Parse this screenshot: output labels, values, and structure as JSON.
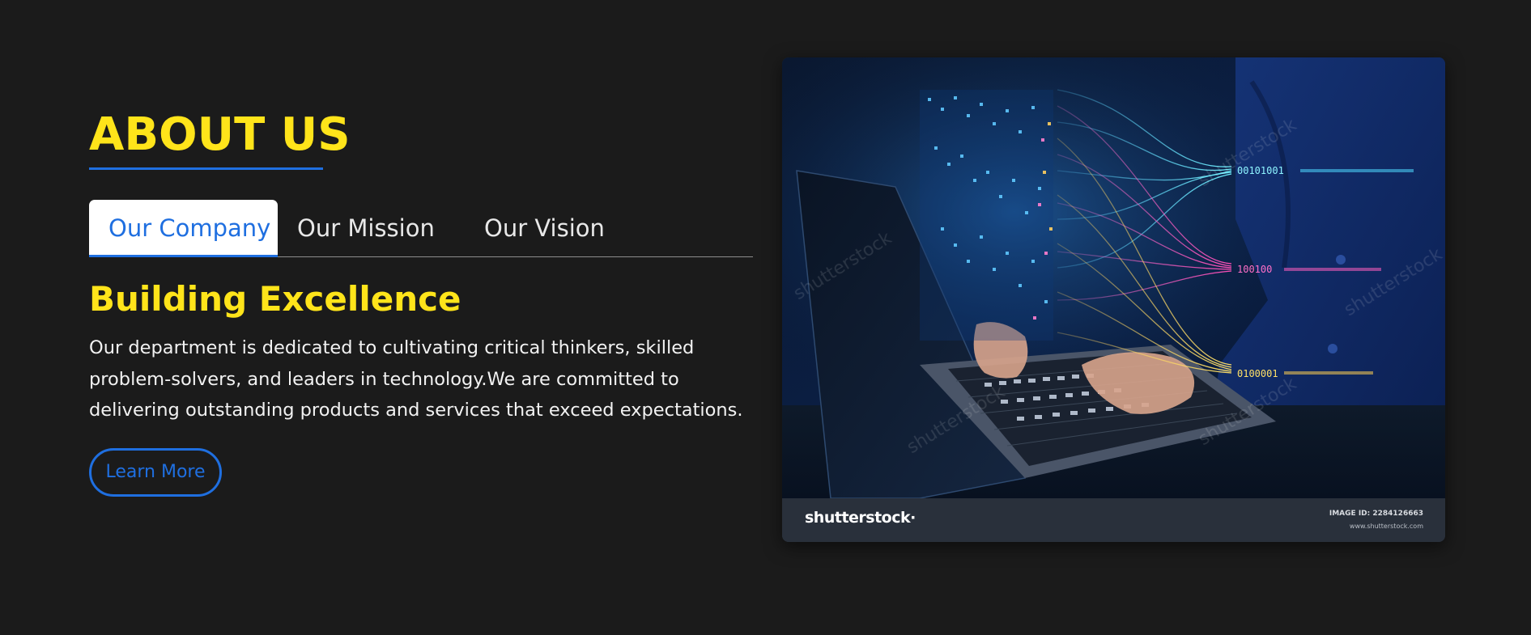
{
  "about": {
    "title": "ABOUT US",
    "tabs": [
      {
        "label": "Our Company",
        "active": true
      },
      {
        "label": "Our Mission",
        "active": false
      },
      {
        "label": "Our Vision",
        "active": false
      }
    ],
    "subheading": "Building Excellence",
    "body": "Our department is dedicated to cultivating critical thinkers, skilled problem-solvers, and leaders in technology.We are committed to delivering outstanding products and services that exceed expectations.",
    "cta_label": "Learn More"
  },
  "image": {
    "brand": "shutterstock",
    "brand_suffix": "·",
    "image_id_label": "IMAGE ID:",
    "image_id": "2284126663",
    "url": "www.shutterstock.com",
    "watermark": "shutterstock"
  },
  "colors": {
    "background": "#1b1b1b",
    "heading_yellow": "#ffe41a",
    "accent_blue": "#1f6fe0",
    "text": "#f2f2f2"
  }
}
